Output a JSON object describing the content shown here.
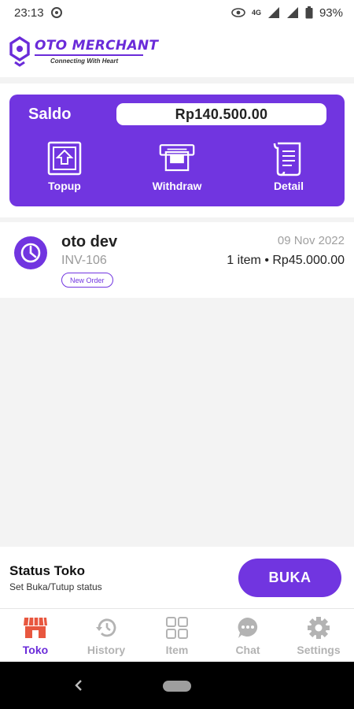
{
  "status_bar": {
    "time": "23:13",
    "network": "4G",
    "battery": "93%"
  },
  "brand": {
    "name": "OTO MERCHANT",
    "tagline": "Connecting With Heart"
  },
  "saldo": {
    "label": "Saldo",
    "amount": "Rp140.500.00",
    "actions": [
      {
        "label": "Topup",
        "icon": "topup-icon"
      },
      {
        "label": "Withdraw",
        "icon": "withdraw-icon"
      },
      {
        "label": "Detail",
        "icon": "receipt-icon"
      }
    ]
  },
  "orders": [
    {
      "name": "oto dev",
      "invoice": "INV-106",
      "status": "New Order",
      "date": "09 Nov 2022",
      "summary": "1 item • Rp45.000.00",
      "icon": "clock-icon"
    }
  ],
  "store_status": {
    "title": "Status Toko",
    "subtitle": "Set Buka/Tutup status",
    "button": "BUKA"
  },
  "nav": {
    "items": [
      {
        "label": "Toko",
        "icon": "store-icon",
        "active": true
      },
      {
        "label": "History",
        "icon": "history-icon",
        "active": false
      },
      {
        "label": "Item",
        "icon": "grid-icon",
        "active": false
      },
      {
        "label": "Chat",
        "icon": "chat-icon",
        "active": false
      },
      {
        "label": "Settings",
        "icon": "gear-icon",
        "active": false
      }
    ]
  },
  "colors": {
    "brand": "#6a2bd9",
    "card": "#7135e0",
    "nav_active": "#e8573f",
    "nav_inactive": "#b3b3b3"
  }
}
